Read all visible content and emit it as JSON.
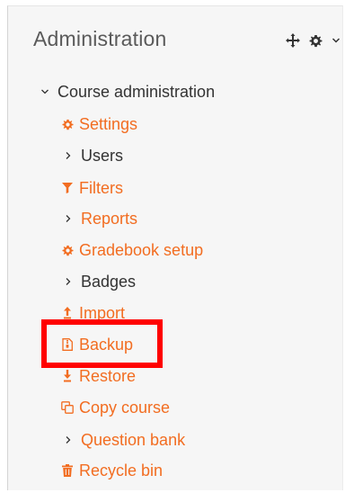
{
  "block": {
    "title": "Administration",
    "controls": {
      "move_icon": "move-icon",
      "gear_icon": "gear-icon",
      "dropdown_icon": "chevron-down-icon"
    }
  },
  "tree": {
    "root_label": "Course administration",
    "items": [
      {
        "label": "Settings",
        "icon": "gear-icon",
        "color": "#f26d21"
      },
      {
        "label": "Users",
        "icon": "chevron-right-icon",
        "color": "#333333"
      },
      {
        "label": "Filters",
        "icon": "filter-icon",
        "color": "#f26d21"
      },
      {
        "label": "Reports",
        "icon": "chevron-right-icon",
        "color": "#f26d21"
      },
      {
        "label": "Gradebook setup",
        "icon": "gear-icon",
        "color": "#f26d21"
      },
      {
        "label": "Badges",
        "icon": "chevron-right-icon",
        "color": "#333333"
      },
      {
        "label": "Import",
        "icon": "upload-icon",
        "color": "#f26d21"
      },
      {
        "label": "Backup",
        "icon": "file-archive-icon",
        "color": "#f26d21"
      },
      {
        "label": "Restore",
        "icon": "download-icon",
        "color": "#f26d21"
      },
      {
        "label": "Copy course",
        "icon": "copy-icon",
        "color": "#f26d21"
      },
      {
        "label": "Question bank",
        "icon": "chevron-right-icon",
        "color": "#f26d21"
      },
      {
        "label": "Recycle bin",
        "icon": "trash-icon",
        "color": "#f26d21"
      }
    ]
  },
  "annotation": {
    "highlight_color": "#ff0000"
  }
}
